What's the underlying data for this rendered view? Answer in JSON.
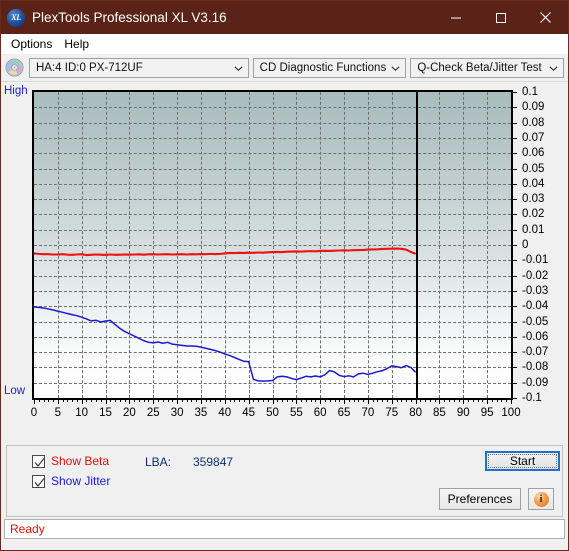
{
  "window": {
    "title": "PlexTools Professional XL V3.16",
    "logo_icon": "xl-logo-icon",
    "minimize_label": "─",
    "maximize_label": "□",
    "close_label": "×"
  },
  "menubar": {
    "items": [
      {
        "label": "Options"
      },
      {
        "label": "Help"
      }
    ]
  },
  "toolbar": {
    "disc_icon": "cd-disc-icon",
    "drive_select": {
      "value": "HA:4 ID:0  PX-712UF",
      "arrow_icon": "chevron-down-icon"
    },
    "function_select": {
      "value": "CD Diagnostic Functions",
      "arrow_icon": "chevron-down-icon"
    },
    "test_select": {
      "value": "Q-Check Beta/Jitter Test",
      "arrow_icon": "chevron-down-icon"
    }
  },
  "controls": {
    "show_beta": {
      "label": "Show Beta",
      "checked": true,
      "color": "#e01010",
      "check_icon": "checkmark-icon"
    },
    "show_jitter": {
      "label": "Show Jitter",
      "checked": true,
      "color": "#1818e0",
      "check_icon": "checkmark-icon"
    },
    "lba": {
      "key": "LBA:",
      "value": "359847"
    },
    "start_button": "Start",
    "preferences_button": "Preferences",
    "info_button": {
      "label": "i",
      "icon": "info-icon"
    }
  },
  "statusbar": {
    "text": "Ready"
  },
  "chart_data": {
    "type": "line",
    "title": "Q-Check Beta/Jitter Test",
    "xlabel": "",
    "ylabel": "",
    "xlim": [
      0,
      100
    ],
    "ylim": [
      -0.1,
      0.1
    ],
    "xticks": [
      0,
      5,
      10,
      15,
      20,
      25,
      30,
      35,
      40,
      45,
      50,
      55,
      60,
      65,
      70,
      75,
      80,
      85,
      90,
      95,
      100
    ],
    "yticks": [
      0.1,
      0.09,
      0.08,
      0.07,
      0.06,
      0.05,
      0.04,
      0.03,
      0.02,
      0.01,
      0,
      -0.01,
      -0.02,
      -0.03,
      -0.04,
      -0.05,
      -0.06,
      -0.07,
      -0.08,
      -0.09,
      -0.1
    ],
    "grid": true,
    "grid_style": "dashed",
    "axis_side_labels": {
      "top": "High",
      "bottom": "Low"
    },
    "data_end_marker_x": 80,
    "legend_position": "below-plot",
    "series": [
      {
        "name": "Show Beta",
        "color": "#ee1111",
        "x": [
          0,
          1,
          2,
          3,
          4,
          5,
          6,
          7,
          8,
          9,
          10,
          11,
          12,
          13,
          14,
          15,
          16,
          17,
          18,
          19,
          20,
          21,
          22,
          23,
          24,
          25,
          26,
          27,
          28,
          29,
          30,
          31,
          32,
          33,
          34,
          35,
          36,
          37,
          38,
          39,
          40,
          41,
          42,
          43,
          44,
          45,
          46,
          47,
          48,
          49,
          50,
          51,
          52,
          53,
          54,
          55,
          56,
          57,
          58,
          59,
          60,
          61,
          62,
          63,
          64,
          65,
          66,
          67,
          68,
          69,
          70,
          71,
          72,
          73,
          74,
          75,
          76,
          77,
          78,
          79,
          80
        ],
        "values": [
          -0.0055,
          -0.0058,
          -0.006,
          -0.006,
          -0.0062,
          -0.0062,
          -0.006,
          -0.0063,
          -0.0064,
          -0.0062,
          -0.006,
          -0.0066,
          -0.0064,
          -0.0062,
          -0.0063,
          -0.0065,
          -0.0062,
          -0.0064,
          -0.0063,
          -0.0062,
          -0.0063,
          -0.0062,
          -0.0061,
          -0.0063,
          -0.0061,
          -0.006,
          -0.0062,
          -0.0061,
          -0.006,
          -0.0062,
          -0.0061,
          -0.006,
          -0.0062,
          -0.006,
          -0.0061,
          -0.0059,
          -0.006,
          -0.0058,
          -0.006,
          -0.0058,
          -0.0055,
          -0.0052,
          -0.0053,
          -0.0051,
          -0.0052,
          -0.005,
          -0.0051,
          -0.0049,
          -0.005,
          -0.0048,
          -0.0046,
          -0.0045,
          -0.0046,
          -0.0044,
          -0.0043,
          -0.0042,
          -0.0043,
          -0.0041,
          -0.004,
          -0.0041,
          -0.0039,
          -0.0038,
          -0.0039,
          -0.0037,
          -0.0036,
          -0.0035,
          -0.0036,
          -0.0034,
          -0.0033,
          -0.0032,
          -0.003,
          -0.0029,
          -0.0028,
          -0.0026,
          -0.0025,
          -0.0024,
          -0.0023,
          -0.0025,
          -0.003,
          -0.0045,
          -0.0058
        ]
      },
      {
        "name": "Show Jitter",
        "color": "#1a1ad0",
        "x": [
          0,
          1,
          2,
          3,
          4,
          5,
          6,
          7,
          8,
          9,
          10,
          11,
          12,
          13,
          14,
          15,
          16,
          17,
          18,
          19,
          20,
          21,
          22,
          23,
          24,
          25,
          26,
          27,
          28,
          29,
          30,
          31,
          32,
          33,
          34,
          35,
          36,
          37,
          38,
          39,
          40,
          41,
          42,
          43,
          44,
          45,
          46,
          47,
          48,
          49,
          50,
          51,
          52,
          53,
          54,
          55,
          56,
          57,
          58,
          59,
          60,
          61,
          62,
          63,
          64,
          65,
          66,
          67,
          68,
          69,
          70,
          71,
          72,
          73,
          74,
          75,
          76,
          77,
          78,
          79,
          80
        ],
        "values": [
          -0.0405,
          -0.0408,
          -0.0412,
          -0.0418,
          -0.0425,
          -0.0432,
          -0.044,
          -0.0448,
          -0.0455,
          -0.0462,
          -0.0472,
          -0.0483,
          -0.0496,
          -0.0492,
          -0.0503,
          -0.0497,
          -0.0493,
          -0.052,
          -0.0545,
          -0.0565,
          -0.058,
          -0.0595,
          -0.061,
          -0.0625,
          -0.0636,
          -0.064,
          -0.0634,
          -0.0642,
          -0.0636,
          -0.0648,
          -0.0652,
          -0.0656,
          -0.066,
          -0.066,
          -0.0662,
          -0.0668,
          -0.0675,
          -0.0682,
          -0.069,
          -0.07,
          -0.0712,
          -0.0722,
          -0.0735,
          -0.0748,
          -0.076,
          -0.0762,
          -0.0878,
          -0.0888,
          -0.089,
          -0.0888,
          -0.0886,
          -0.0862,
          -0.0858,
          -0.0862,
          -0.0872,
          -0.088,
          -0.087,
          -0.0858,
          -0.0862,
          -0.0856,
          -0.0862,
          -0.0848,
          -0.082,
          -0.083,
          -0.0852,
          -0.086,
          -0.0855,
          -0.0862,
          -0.0842,
          -0.0838,
          -0.0846,
          -0.0838,
          -0.0828,
          -0.0822,
          -0.0808,
          -0.079,
          -0.0795,
          -0.0802,
          -0.0788,
          -0.08,
          -0.0832
        ]
      }
    ]
  }
}
